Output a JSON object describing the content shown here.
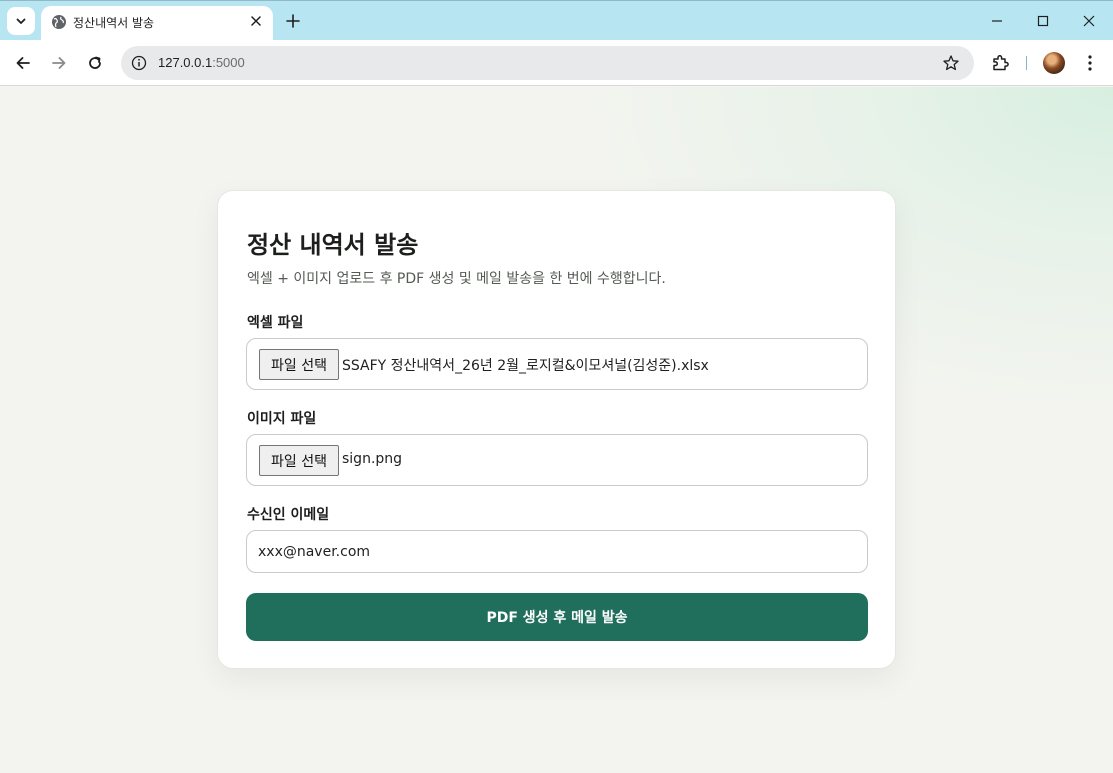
{
  "browser": {
    "tab_title": "정산내역서 발송",
    "url_host": "127.0.0.1",
    "url_port": ":5000"
  },
  "page": {
    "title": "정산 내역서 발송",
    "description": "엑셀 + 이미지 업로드 후 PDF 생성 및 메일 발송을 한 번에 수행합니다.",
    "excel_field": {
      "label": "엑셀 파일",
      "button_label": "파일 선택",
      "file_name": "SSAFY 정산내역서_26년 2월_로지컬&이모셔널(김성준).xlsx"
    },
    "image_field": {
      "label": "이미지 파일",
      "button_label": "파일 선택",
      "file_name": "sign.png"
    },
    "email_field": {
      "label": "수신인 이메일",
      "value": "xxx@naver.com"
    },
    "submit_label": "PDF 생성 후 메일 발송"
  },
  "colors": {
    "tab_strip": "#b7e6f2",
    "accent_button": "#1f6f5c",
    "page_background": "#f3f4ef"
  }
}
